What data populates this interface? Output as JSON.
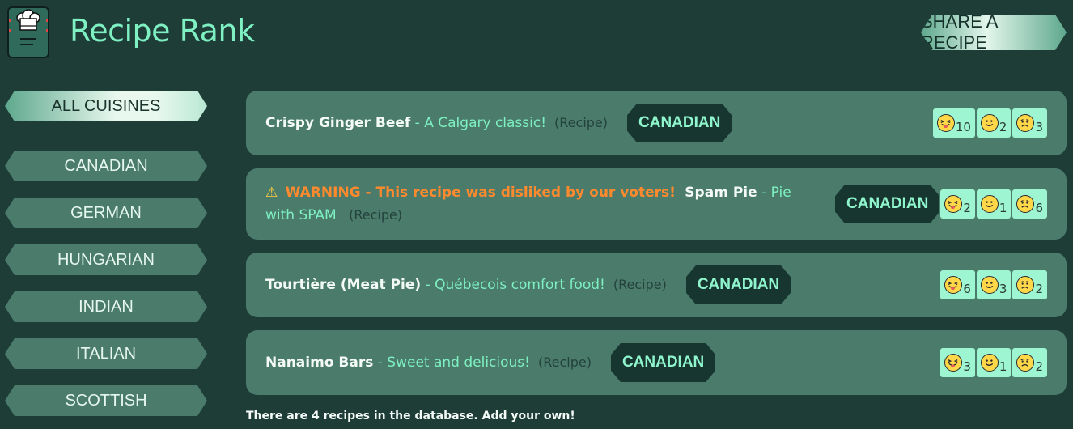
{
  "header": {
    "app_title": "Recipe Rank",
    "logo_icon": "chef-hat-book-icon",
    "share_label": "SHARE A RECIPE"
  },
  "sidebar": {
    "items": [
      {
        "label": "ALL CUISINES",
        "active": true
      },
      {
        "label": "CANADIAN",
        "active": false
      },
      {
        "label": "GERMAN",
        "active": false
      },
      {
        "label": "HUNGARIAN",
        "active": false
      },
      {
        "label": "INDIAN",
        "active": false
      },
      {
        "label": "ITALIAN",
        "active": false
      },
      {
        "label": "SCOTTISH",
        "active": false
      }
    ]
  },
  "recipes": [
    {
      "name": "Crispy Ginger Beef",
      "separator": " - ",
      "description": "A Calgary classic!",
      "link": "(Recipe)",
      "cuisine": "CANADIAN",
      "warning": "",
      "votes": {
        "loved": "10",
        "liked": "2",
        "disliked": "3"
      }
    },
    {
      "name": "Spam Pie",
      "separator": " - ",
      "description": "Pie with SPAM",
      "link": "(Recipe)",
      "cuisine": "CANADIAN",
      "warning": "WARNING - This recipe was disliked by our voters!",
      "warning_icon": "⚠",
      "votes": {
        "loved": "2",
        "liked": "1",
        "disliked": "6"
      }
    },
    {
      "name": "Tourtière (Meat Pie)",
      "separator": " - ",
      "description": "Québecois comfort food!",
      "link": "(Recipe)",
      "cuisine": "CANADIAN",
      "warning": "",
      "votes": {
        "loved": "6",
        "liked": "3",
        "disliked": "2"
      }
    },
    {
      "name": "Nanaimo Bars",
      "separator": " - ",
      "description": "Sweet and delicious!",
      "link": "(Recipe)",
      "cuisine": "CANADIAN",
      "warning": "",
      "votes": {
        "loved": "3",
        "liked": "1",
        "disliked": "2"
      }
    }
  ],
  "vote_icons": [
    "tongue-out-face-icon",
    "smiley-face-icon",
    "frowning-face-icon"
  ],
  "footer": {
    "text": "There are 4 recipes in the database. Add your own!"
  },
  "colors": {
    "background": "#1e3d37",
    "card": "#4a7b6b",
    "accent": "#7ef0c2",
    "warning": "#ff8a2e",
    "tag_bg": "#183630"
  }
}
